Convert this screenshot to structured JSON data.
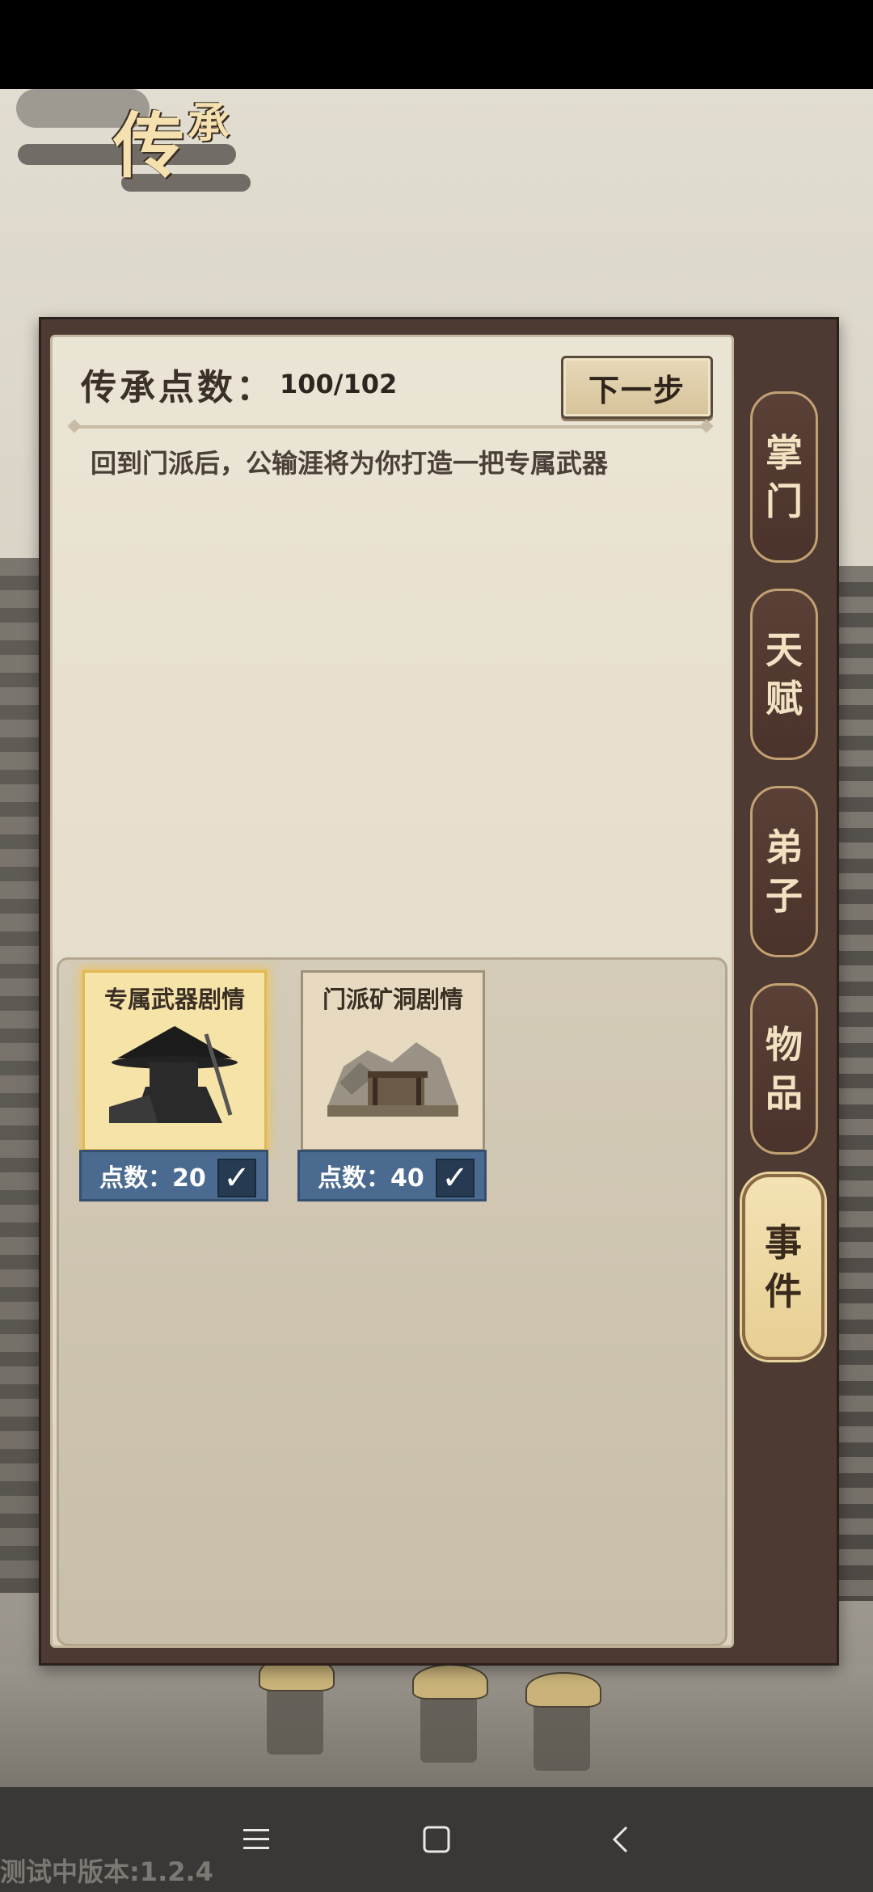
{
  "header": {
    "title_main": "传",
    "title_small": "承"
  },
  "points": {
    "label": "传承点数：",
    "value": "100/102"
  },
  "next_button": {
    "label": "下一步"
  },
  "description": "回到门派后，公输涯将为你打造一把专属武器",
  "events": [
    {
      "title": "专属武器剧情",
      "points_label": "点数：20",
      "checked": true,
      "selected": true
    },
    {
      "title": "门派矿洞剧情",
      "points_label": "点数：40",
      "checked": true,
      "selected": false
    }
  ],
  "side_tabs": [
    {
      "char1": "掌",
      "char2": "门",
      "active": false
    },
    {
      "char1": "天",
      "char2": "赋",
      "active": false
    },
    {
      "char1": "弟",
      "char2": "子",
      "active": false
    },
    {
      "char1": "物",
      "char2": "品",
      "active": false
    },
    {
      "char1": "事",
      "char2": "件",
      "active": true
    }
  ],
  "nav": {
    "menu_icon": "menu-icon",
    "home_icon": "home-icon",
    "back_icon": "back-icon"
  },
  "version_text": "测试中版本:1.2.4"
}
